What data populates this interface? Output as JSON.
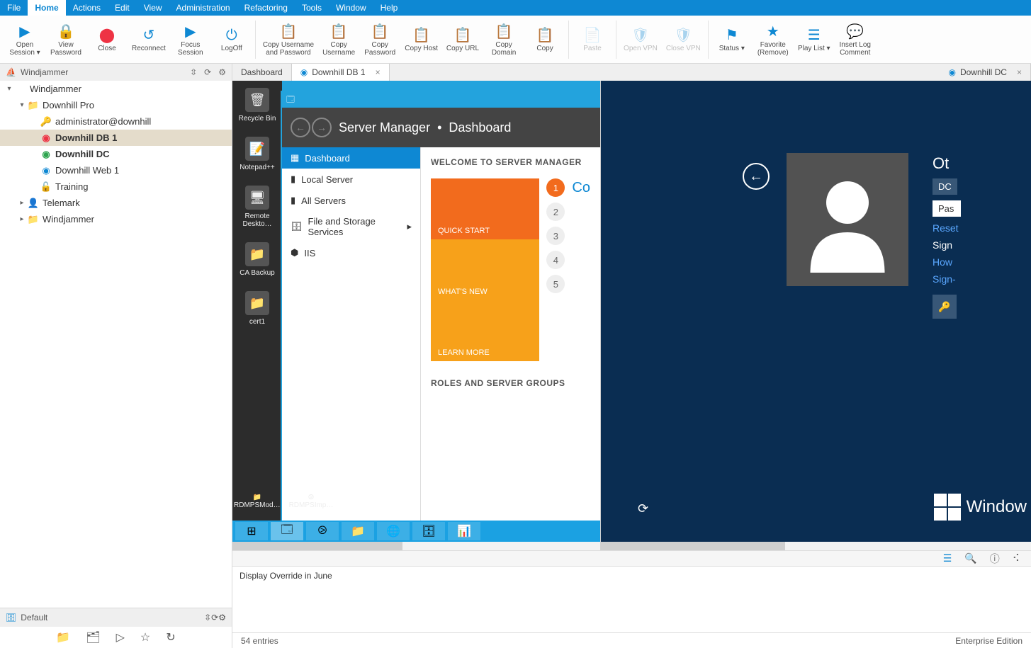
{
  "menu": [
    "File",
    "Home",
    "Actions",
    "Edit",
    "View",
    "Administration",
    "Refactoring",
    "Tools",
    "Window",
    "Help"
  ],
  "menu_active_index": 1,
  "ribbon": [
    {
      "label": "Open\nSession ▾",
      "icon": "▶",
      "drop": true
    },
    {
      "label": "View\nPassword",
      "icon": "🔒"
    },
    {
      "label": "Close",
      "icon": "⬤",
      "color": "#e34"
    },
    {
      "label": "Reconnect",
      "icon": "↺"
    },
    {
      "label": "Focus\nSession",
      "icon": "▶"
    },
    {
      "label": "LogOff",
      "icon": "⏻"
    },
    {
      "sep": true
    },
    {
      "label": "Copy Username\nand Password",
      "icon": "📋"
    },
    {
      "label": "Copy\nUsername",
      "icon": "📋"
    },
    {
      "label": "Copy\nPassword",
      "icon": "📋"
    },
    {
      "label": "Copy Host",
      "icon": "📋"
    },
    {
      "label": "Copy URL",
      "icon": "📋"
    },
    {
      "label": "Copy\nDomain",
      "icon": "📋"
    },
    {
      "label": "Copy",
      "icon": "📋"
    },
    {
      "sep": true
    },
    {
      "label": "Paste",
      "icon": "📄",
      "disabled": true
    },
    {
      "sep": true
    },
    {
      "label": "Open VPN",
      "icon": "🛡",
      "disabled": true
    },
    {
      "label": "Close VPN",
      "icon": "🛡",
      "disabled": true
    },
    {
      "sep": true
    },
    {
      "label": "Status ▾",
      "icon": "⚑"
    },
    {
      "label": "Favorite\n(Remove)",
      "icon": "★"
    },
    {
      "label": "Play List ▾",
      "icon": "☰"
    },
    {
      "label": "Insert Log\nComment",
      "icon": "💬"
    }
  ],
  "side_title": "Windjammer",
  "tree": [
    {
      "d": 0,
      "arrow": "▾",
      "icon": "",
      "iclr": "#888",
      "label": "Windjammer"
    },
    {
      "d": 1,
      "arrow": "▾",
      "icon": "📁",
      "iclr": "#8a8a8a",
      "label": "Downhill Pro"
    },
    {
      "d": 2,
      "arrow": "",
      "icon": "🔑",
      "iclr": "#f0a000",
      "label": "administrator@downhill"
    },
    {
      "d": 2,
      "arrow": "",
      "icon": "◉",
      "iclr": "#e34",
      "label": "Downhill DB 1",
      "sel": true,
      "bold": true
    },
    {
      "d": 2,
      "arrow": "",
      "icon": "◉",
      "iclr": "#2da44e",
      "label": "Downhill DC",
      "bold": true
    },
    {
      "d": 2,
      "arrow": "",
      "icon": "◉",
      "iclr": "#0e88d3",
      "label": "Downhill Web 1"
    },
    {
      "d": 2,
      "arrow": "",
      "icon": "🔓",
      "iclr": "#f0a000",
      "label": "Training"
    },
    {
      "d": 1,
      "arrow": "▸",
      "icon": "👤",
      "iclr": "#888",
      "label": "Telemark"
    },
    {
      "d": 1,
      "arrow": "▸",
      "icon": "📁",
      "iclr": "#8a8a8a",
      "label": "Windjammer"
    }
  ],
  "foot_label": "Default",
  "tabs": [
    {
      "label": "Dashboard",
      "active": false,
      "closable": false,
      "icon": ""
    },
    {
      "label": "Downhill DB 1",
      "active": true,
      "closable": true,
      "icon": "◉"
    },
    {
      "label": "Downhill DC",
      "active": false,
      "closable": true,
      "icon": "◉",
      "push": true
    }
  ],
  "sm": {
    "title": "Server Manager",
    "crumb": "Dashboard",
    "nav": [
      "Dashboard",
      "Local Server",
      "All Servers",
      "File and Storage Services",
      "IIS"
    ],
    "welcome": "WELCOME TO SERVER MANAGER",
    "tiles": [
      "QUICK START",
      "WHAT'S NEW",
      "LEARN MORE"
    ],
    "step1": "Co",
    "roles": "ROLES AND SERVER GROUPS"
  },
  "desk_icons": [
    "Recycle Bin",
    "Notepad++",
    "Remote Deskto…",
    "CA Backup",
    "cert1",
    "RDMPSMod…",
    "RDMPSImp…"
  ],
  "login": {
    "other": "Ot",
    "chip": "DC",
    "pass": "Pas",
    "links": [
      "Reset",
      "Sign",
      "How",
      "Sign-"
    ],
    "brand": "Window"
  },
  "log_text": "Display Override in June",
  "status_left": "54 entries",
  "status_right": "Enterprise Edition"
}
